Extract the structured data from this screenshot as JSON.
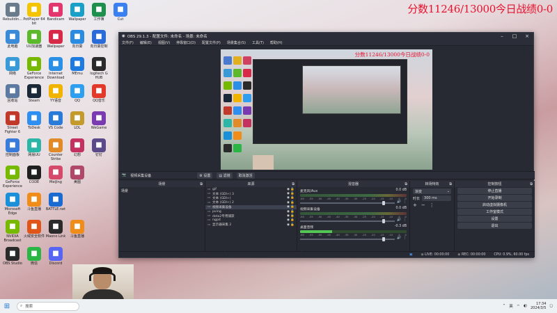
{
  "overlay": {
    "score_text": "分数11246/13000今日战绩0-0"
  },
  "desktop": {
    "icons": [
      {
        "label": "Rebuildin...",
        "color": "#6a7b8c",
        "col": 0,
        "row": 0
      },
      {
        "label": "PotPlayer 64 bit",
        "color": "#f5c400",
        "col": 1,
        "row": 0
      },
      {
        "label": "Bandicam",
        "color": "#e2366f",
        "col": 2,
        "row": 0
      },
      {
        "label": "Wallpaper",
        "color": "#18a0c8",
        "col": 3,
        "row": 0
      },
      {
        "label": "工作簿",
        "color": "#1f8f4d",
        "col": 4,
        "row": 0
      },
      {
        "label": "Cut",
        "color": "#3a80f0",
        "col": 5,
        "row": 0
      },
      {
        "label": "此电脑",
        "color": "#3b8ad8",
        "col": 0,
        "row": 1
      },
      {
        "label": "UU加速器",
        "color": "#5cb92b",
        "col": 1,
        "row": 1
      },
      {
        "label": "Wallpaper",
        "color": "#d72a48",
        "col": 2,
        "row": 1
      },
      {
        "label": "向日葵",
        "color": "#2a8be0",
        "col": 3,
        "row": 1
      },
      {
        "label": "向日葵控制",
        "color": "#2a6bd8",
        "col": 4,
        "row": 1
      },
      {
        "label": "网络",
        "color": "#3a9ad8",
        "col": 0,
        "row": 2
      },
      {
        "label": "GeForce Experience",
        "color": "#76b900",
        "col": 1,
        "row": 2
      },
      {
        "label": "Internet Download",
        "color": "#2c8fe6",
        "col": 2,
        "row": 2
      },
      {
        "label": "MEmu",
        "color": "#1e7be0",
        "col": 3,
        "row": 2
      },
      {
        "label": "logitech G HUB",
        "color": "#2b2b2b",
        "col": 4,
        "row": 2
      },
      {
        "label": "回收站",
        "color": "#5d7aa0",
        "col": 0,
        "row": 3
      },
      {
        "label": "Steam",
        "color": "#1b2838",
        "col": 1,
        "row": 3
      },
      {
        "label": "YY语音",
        "color": "#f0b400",
        "col": 2,
        "row": 3
      },
      {
        "label": "QQ",
        "color": "#2e9ef0",
        "col": 3,
        "row": 3
      },
      {
        "label": "QQ音乐",
        "color": "#e23a2a",
        "col": 4,
        "row": 3
      },
      {
        "label": "Street Fighter 6",
        "color": "#c0392b",
        "col": 0,
        "row": 4
      },
      {
        "label": "ToDesk",
        "color": "#2e8ff0",
        "col": 1,
        "row": 4
      },
      {
        "label": "VS Code",
        "color": "#2a7ad8",
        "col": 2,
        "row": 4
      },
      {
        "label": "LOL",
        "color": "#c39a2c",
        "col": 3,
        "row": 4
      },
      {
        "label": "WeGame",
        "color": "#7a3ab0",
        "col": 4,
        "row": 4
      },
      {
        "label": "控制面板",
        "color": "#3a7ad8",
        "col": 0,
        "row": 5
      },
      {
        "label": "网易UU",
        "color": "#2bb6a8",
        "col": 1,
        "row": 5
      },
      {
        "label": "Counter Strike",
        "color": "#e08a2a",
        "col": 2,
        "row": 5
      },
      {
        "label": "幻想",
        "color": "#c43060",
        "col": 3,
        "row": 5
      },
      {
        "label": "钉钉",
        "color": "#5a4a8a",
        "col": 4,
        "row": 5
      },
      {
        "label": "GeForce Experience",
        "color": "#76b900",
        "col": 0,
        "row": 6
      },
      {
        "label": "CODE",
        "color": "#1f1f1f",
        "col": 1,
        "row": 6
      },
      {
        "label": "MeiJing",
        "color": "#d44a6a",
        "col": 2,
        "row": 6
      },
      {
        "label": "美图",
        "color": "#b0486a",
        "col": 3,
        "row": 6
      },
      {
        "label": "Microsoft Edge",
        "color": "#1b8fd8",
        "col": 0,
        "row": 7
      },
      {
        "label": "斗鱼直播",
        "color": "#f08c1a",
        "col": 1,
        "row": 7
      },
      {
        "label": "BATTLE.net",
        "color": "#1a6ad0",
        "col": 2,
        "row": 7
      },
      {
        "label": "NVIDIA Broadcast",
        "color": "#76b900",
        "col": 0,
        "row": 8
      },
      {
        "label": "火绒安全软件",
        "color": "#e0551a",
        "col": 1,
        "row": 8
      },
      {
        "label": "Maono Link",
        "color": "#2a2a2a",
        "col": 2,
        "row": 8
      },
      {
        "label": "斗鱼直播",
        "color": "#f08c1a",
        "col": 3,
        "row": 8
      },
      {
        "label": "OBS Studio",
        "color": "#2a2a2a",
        "col": 0,
        "row": 9
      },
      {
        "label": "微信",
        "color": "#2bb544",
        "col": 1,
        "row": 9
      },
      {
        "label": "Discord",
        "color": "#5865f2",
        "col": 2,
        "row": 9
      }
    ]
  },
  "obs": {
    "title": "OBS 29.1.3 - 配置文件: 未命名 - 场景: 未命名",
    "menu": [
      "文件(F)",
      "编辑(E)",
      "视图(V)",
      "停靠窗口(D)",
      "配置文件(P)",
      "场景集合(S)",
      "工具(T)",
      "帮助(H)"
    ],
    "source_bar": {
      "current_source": "视频采集设备",
      "settings": "设置",
      "filters": "滤镜",
      "deactivate": "取消激活"
    },
    "preview_overlay_text": "分数11246/13000今日战绩0-0",
    "docks": {
      "scenes": {
        "title": "场景",
        "items": [
          "场景"
        ]
      },
      "sources": {
        "title": "来源",
        "items": [
          {
            "name": "gif",
            "selected": false
          },
          {
            "name": "文本 (GDI+) 3",
            "selected": false
          },
          {
            "name": "文本 (GDI+)",
            "selected": false
          },
          {
            "name": "文本 (GDI+) 2",
            "selected": false
          },
          {
            "name": "视频采集设备",
            "selected": true
          },
          {
            "name": "pving",
            "selected": false
          },
          {
            "name": "dota2专用捕获",
            "selected": false
          },
          {
            "name": "ngpd",
            "selected": false
          },
          {
            "name": "显示器采集 2",
            "selected": false
          }
        ]
      },
      "mixer": {
        "title": "混音器",
        "tracks": [
          {
            "name": "麦克风/Aux",
            "db": "0.0 dB",
            "level": 0
          },
          {
            "name": "视频采集设备",
            "db": "0.0 dB",
            "level": 0
          },
          {
            "name": "桌面音频",
            "db": "-0.3 dB",
            "level": 0.3
          }
        ],
        "scale": [
          "-60",
          "-55",
          "-50",
          "-45",
          "-40",
          "-35",
          "-30",
          "-25",
          "-20",
          "-15",
          "-10",
          "-5",
          "0"
        ]
      },
      "transitions": {
        "title": "转场特效",
        "type": "渐变",
        "duration_label": "时长",
        "duration": "300 ms"
      },
      "controls": {
        "title": "控制按钮",
        "buttons": [
          "停止直播",
          "开始录制",
          "启动虚拟摄像机",
          "工作室模式",
          "设置",
          "退出"
        ]
      }
    },
    "status": {
      "live": "LIVE: 00:00:00",
      "rec": "REC: 00:00:00",
      "cpu": "CPU: 0.9%, 60.00 fps"
    }
  },
  "taskbar": {
    "search_placeholder": "搜索",
    "ime": "英",
    "time": "17:34",
    "date": "2024/3/5"
  }
}
